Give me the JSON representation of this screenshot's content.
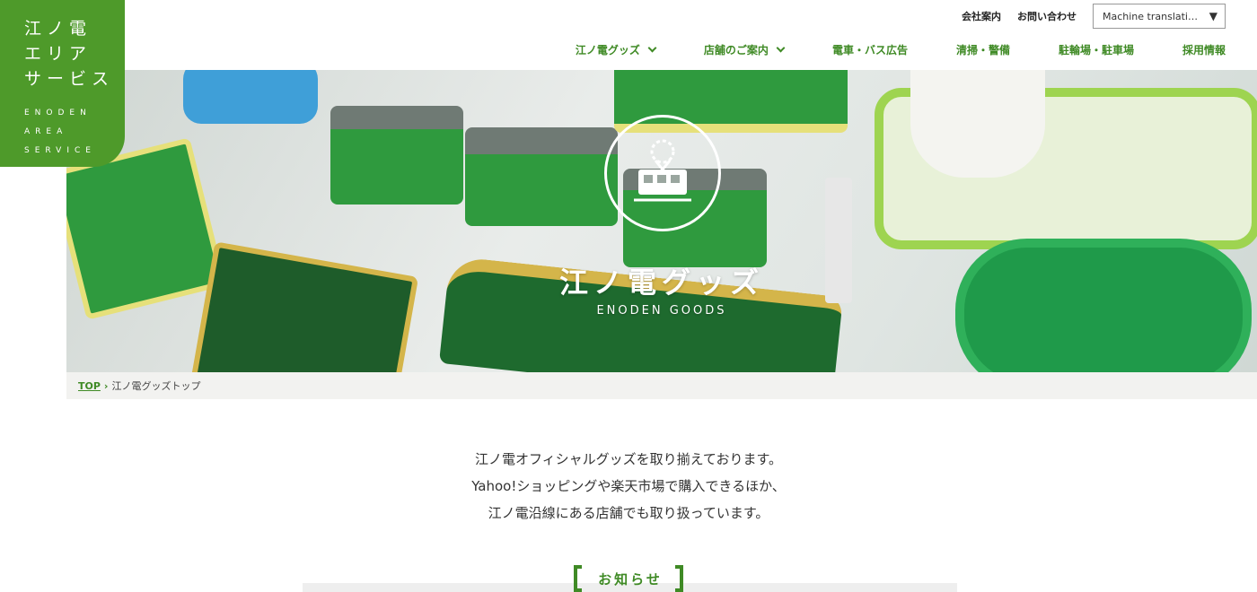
{
  "logo": {
    "line1": "江ノ電",
    "line2": "エリア",
    "line3": "サービス",
    "en1": "ENODEN",
    "en2": "AREA",
    "en3": "SERVICE"
  },
  "utility_nav": {
    "company": "会社案内",
    "contact": "お問い合わせ",
    "language_select": "Machine translati…"
  },
  "main_nav": [
    {
      "label": "江ノ電グッズ",
      "has_dropdown": true
    },
    {
      "label": "店舗のご案内",
      "has_dropdown": true
    },
    {
      "label": "電車・バス広告",
      "has_dropdown": false
    },
    {
      "label": "清掃・警備",
      "has_dropdown": false
    },
    {
      "label": "駐輪場・駐車場",
      "has_dropdown": false
    },
    {
      "label": "採用情報",
      "has_dropdown": false
    }
  ],
  "hero": {
    "title": "江ノ電グッズ",
    "subtitle": "ENODEN GOODS",
    "icon": "tram-icon"
  },
  "breadcrumb": {
    "top": "TOP",
    "current": "江ノ電グッズトップ"
  },
  "intro": {
    "line1": "江ノ電オフィシャルグッズを取り揃えております。",
    "line2": "Yahoo!ショッピングや楽天市場で購入できるほか、",
    "line3": "江ノ電沿線にある店舗でも取り扱っています。"
  },
  "news": {
    "heading": "お知らせ"
  },
  "colors": {
    "brand_green": "#4e9a2a",
    "nav_green": "#3f8a25"
  }
}
